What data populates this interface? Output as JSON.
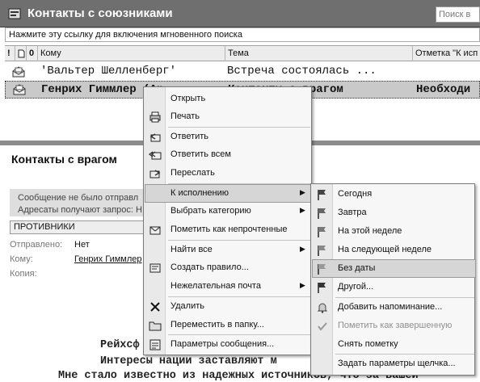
{
  "folder": {
    "title": "Контакты с союзниками",
    "search_placeholder": "Поиск в",
    "instant_search_prompt": "Нажмите эту ссылку для включения мгновенного поиска"
  },
  "columns": {
    "importance": "!",
    "type": "🗋",
    "attachment": "0",
    "to": "Кому",
    "subject": "Тема",
    "flag": "Отметка \"К исп"
  },
  "messages": [
    {
      "to": "'Вальтер Шелленберг'",
      "subject": "Встреча состоялась ...",
      "flag": ""
    },
    {
      "to": "Генрих Гиммлер (An",
      "subject": "Контакты с врагом",
      "flag": "Необходи"
    }
  ],
  "reading_pane": {
    "subject": "Контакты с врагом",
    "info_line1": "Сообщение не было отправл",
    "info_line2": "Адресаты получают запрос: Н",
    "category": "ПРОТИВНИКИ",
    "sent_label": "Отправлено:",
    "sent_value": "Нет",
    "to_label": "Кому:",
    "to_value": "Генрих Гиммлер",
    "cc_label": "Копия:",
    "body_lines": [
      "Рейхсф",
      "Интересы нации заставляют м",
      "Мне стало известно из надежных источников, что за вашей"
    ]
  },
  "context_menu": {
    "items": [
      {
        "label": "Открыть",
        "icon": "open-icon"
      },
      {
        "label": "Печать",
        "icon": "printer-icon"
      },
      {
        "label": "Ответить",
        "icon": "reply-icon"
      },
      {
        "label": "Ответить всем",
        "icon": "reply-all-icon"
      },
      {
        "label": "Переслать",
        "icon": "forward-icon"
      },
      {
        "label": "К исполнению",
        "icon": ""
      },
      {
        "label": "Выбрать категорию",
        "icon": ""
      },
      {
        "label": "Пометить как непрочтенные",
        "icon": "mark-unread-icon"
      },
      {
        "label": "Найти все",
        "icon": ""
      },
      {
        "label": "Создать правило...",
        "icon": "rule-icon"
      },
      {
        "label": "Нежелательная почта",
        "icon": ""
      },
      {
        "label": "Удалить",
        "icon": "delete-icon"
      },
      {
        "label": "Переместить в папку...",
        "icon": "move-folder-icon"
      },
      {
        "label": "Параметры сообщения...",
        "icon": "options-icon"
      }
    ]
  },
  "followup_menu": {
    "items": [
      {
        "label": "Сегодня",
        "icon": "flag-icon"
      },
      {
        "label": "Завтра",
        "icon": "flag-icon"
      },
      {
        "label": "На этой неделе",
        "icon": "flag-icon"
      },
      {
        "label": "На следующей неделе",
        "icon": "flag-icon"
      },
      {
        "label": "Без даты",
        "icon": "flag-icon"
      },
      {
        "label": "Другой...",
        "icon": "flag-icon"
      },
      {
        "label": "Добавить напоминание...",
        "icon": "bell-icon"
      },
      {
        "label": "Пометить как завершенную",
        "icon": "checkmark-icon"
      },
      {
        "label": "Снять пометку",
        "icon": ""
      },
      {
        "label": "Задать параметры щелчка...",
        "icon": ""
      }
    ]
  }
}
